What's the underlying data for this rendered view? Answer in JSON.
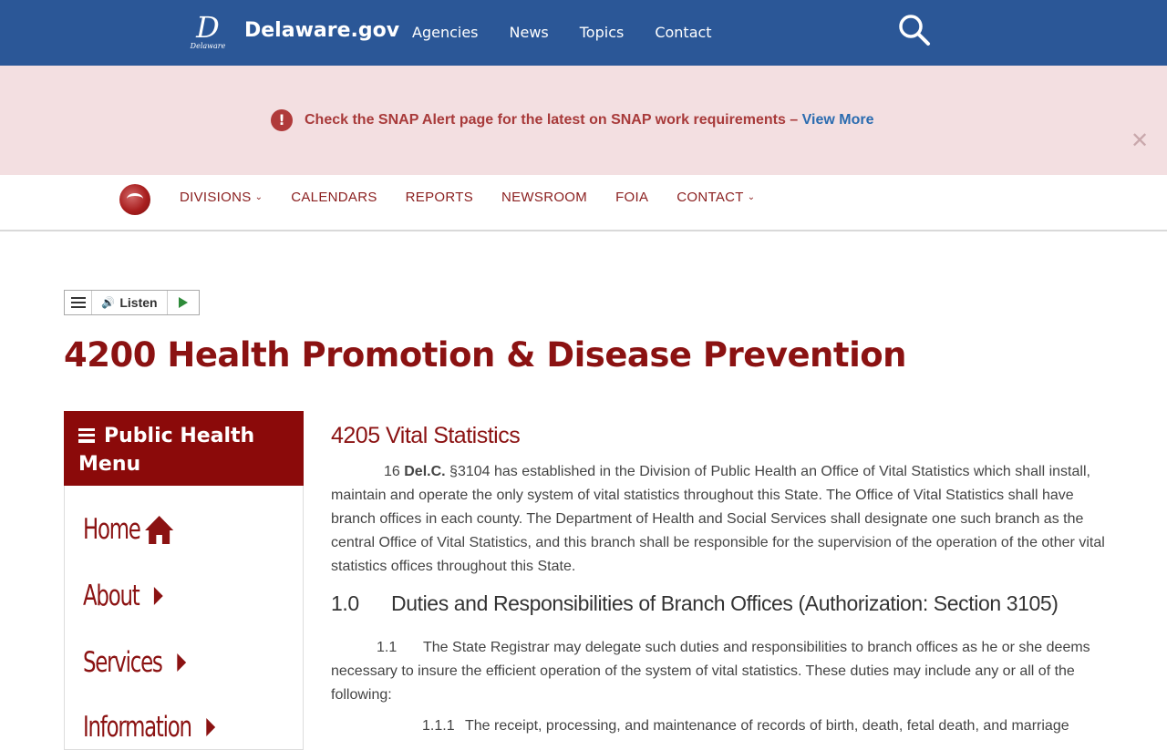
{
  "topbar": {
    "logo_letter": "D",
    "logo_caption": "Delaware",
    "site_name": "Delaware.gov",
    "nav": [
      "Agencies",
      "News",
      "Topics",
      "Contact"
    ],
    "search_icon": "search-icon"
  },
  "alert": {
    "icon": "!",
    "message": "Check the SNAP Alert page for the latest on SNAP work requirements – ",
    "link": "View More",
    "close": "✕"
  },
  "subnav": {
    "items": [
      {
        "label": "DIVISIONS",
        "caret": "⌄"
      },
      {
        "label": "CALENDARS"
      },
      {
        "label": "REPORTS"
      },
      {
        "label": "NEWSROOM"
      },
      {
        "label": "FOIA"
      },
      {
        "label": "CONTACT",
        "caret": "⌄"
      }
    ]
  },
  "listen": {
    "label": "Listen",
    "speaker": "🔊"
  },
  "page": {
    "title": "4200 Health Promotion & Disease Prevention"
  },
  "sidemenu": {
    "title": "Public Health Menu",
    "items": [
      "Home",
      "About",
      "Services",
      "Information"
    ]
  },
  "content": {
    "heading": "4205 Vital Statistics",
    "intro_prefix": "16 ",
    "intro_bold": "Del.C.",
    "intro_rest": " §3104 has established in the Division of Public Health an Office of Vital Statistics which shall install, maintain and operate the only system of vital statistics throughout this State.  The Office of Vital Statistics shall have branch offices in each county.  The Department of Health and Social Services shall designate one such branch as the central Office of Vital Statistics, and this branch shall be responsible for the supervision of the operation of the other vital statistics offices throughout this State.",
    "section_number": "1.0",
    "section_title": "Duties and Responsibilities of Branch Offices (Authorization: Section 3105)",
    "p11_number": "1.1",
    "p11_text": "The State Registrar may delegate such duties and responsibilities to branch offices as he or she deems necessary to insure the efficient operation of the system of vital statistics.  These duties may include any or all of the following:",
    "p111_number": "1.1.1",
    "p111_text": "The receipt, processing, and maintenance of records of birth, death, fetal death, and marriage"
  },
  "colors": {
    "topbar": "#2b5797",
    "alert_bg": "#f3dfe1",
    "brand_red": "#8b1212"
  }
}
